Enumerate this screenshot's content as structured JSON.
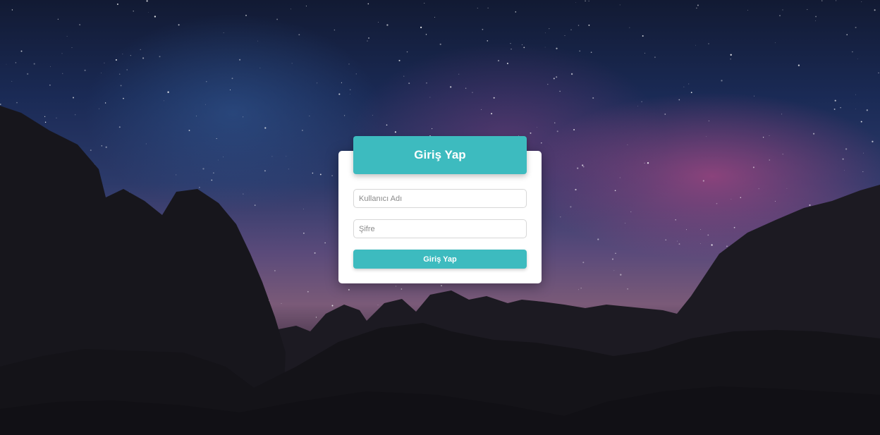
{
  "login": {
    "title": "Giriş Yap",
    "username": {
      "placeholder": "Kullanıcı Adı",
      "value": ""
    },
    "password": {
      "placeholder": "Şifre",
      "value": ""
    },
    "submit_label": "Giriş Yap"
  },
  "colors": {
    "accent": "#3dbbbf",
    "card": "#ffffff"
  }
}
